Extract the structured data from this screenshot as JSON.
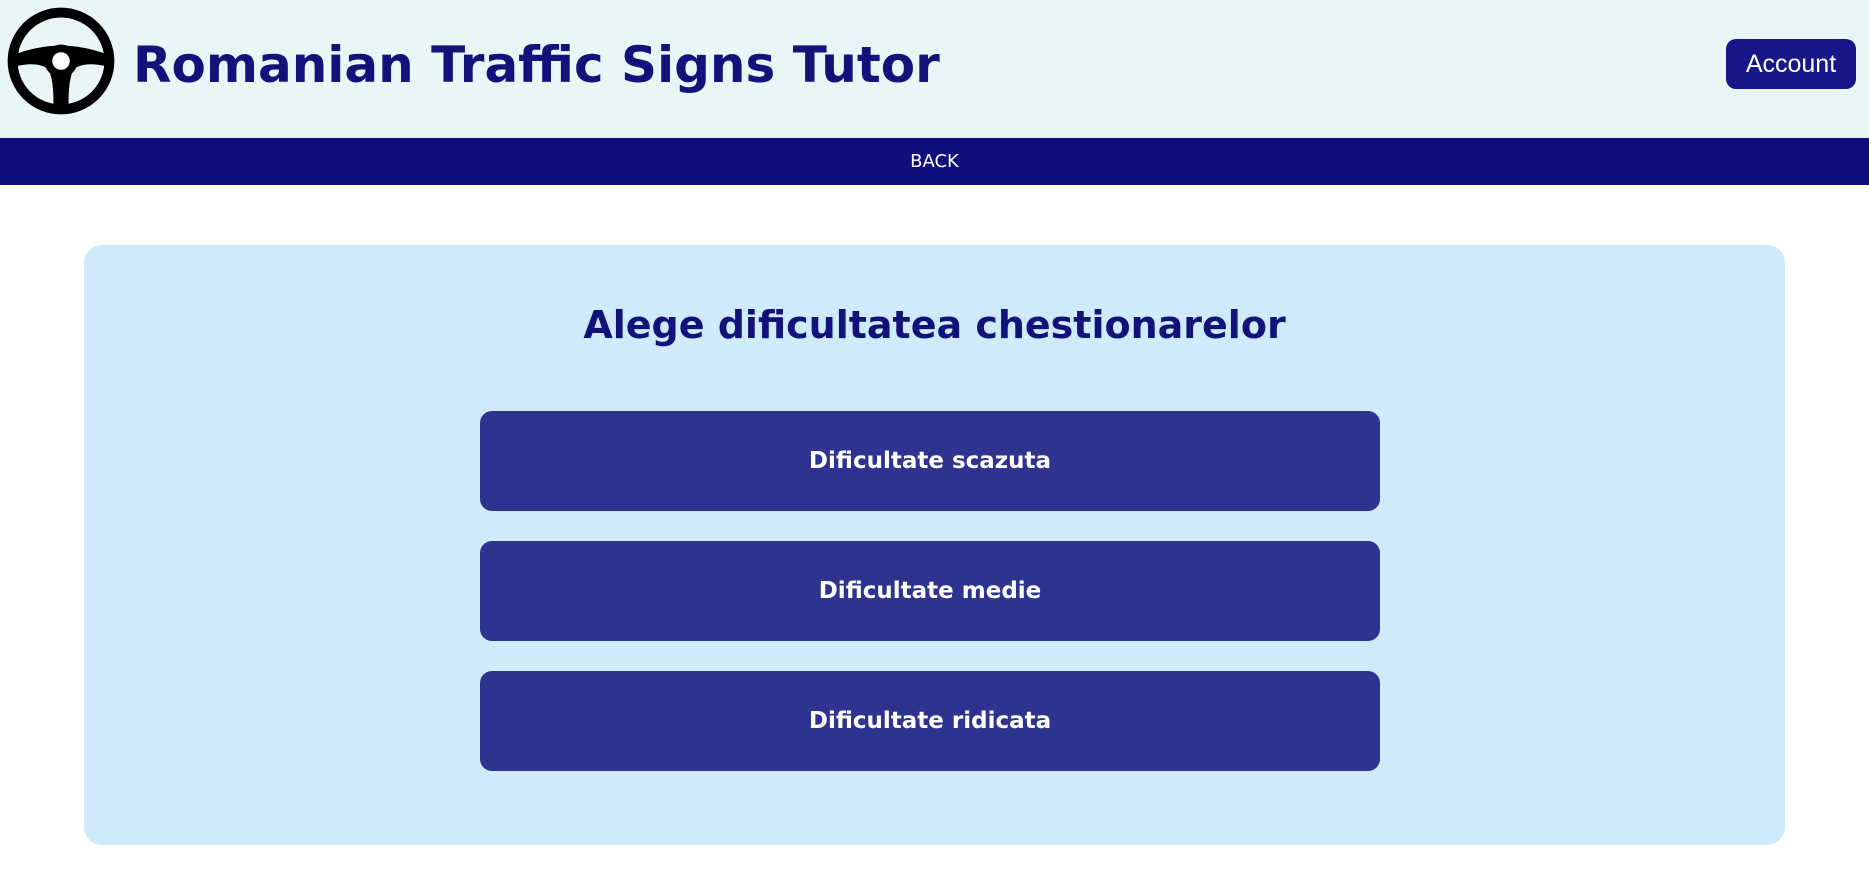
{
  "header": {
    "title": "Romanian Traffic Signs Tutor",
    "logo_icon": "steering-wheel-icon",
    "account_label": "Account"
  },
  "nav": {
    "back_label": "BACK"
  },
  "main": {
    "heading": "Alege dificultatea chestionarelor",
    "options": [
      {
        "label": "Dificultate scazuta"
      },
      {
        "label": "Dificultate medie"
      },
      {
        "label": "Dificultate ridicata"
      }
    ]
  },
  "colors": {
    "header_bg": "#e8f6f8",
    "nav_bg": "#0e0e7c",
    "title_text": "#11127a",
    "panel_bg": "#cfeafb",
    "button_bg": "#2e3390",
    "account_bg": "#17178a"
  }
}
